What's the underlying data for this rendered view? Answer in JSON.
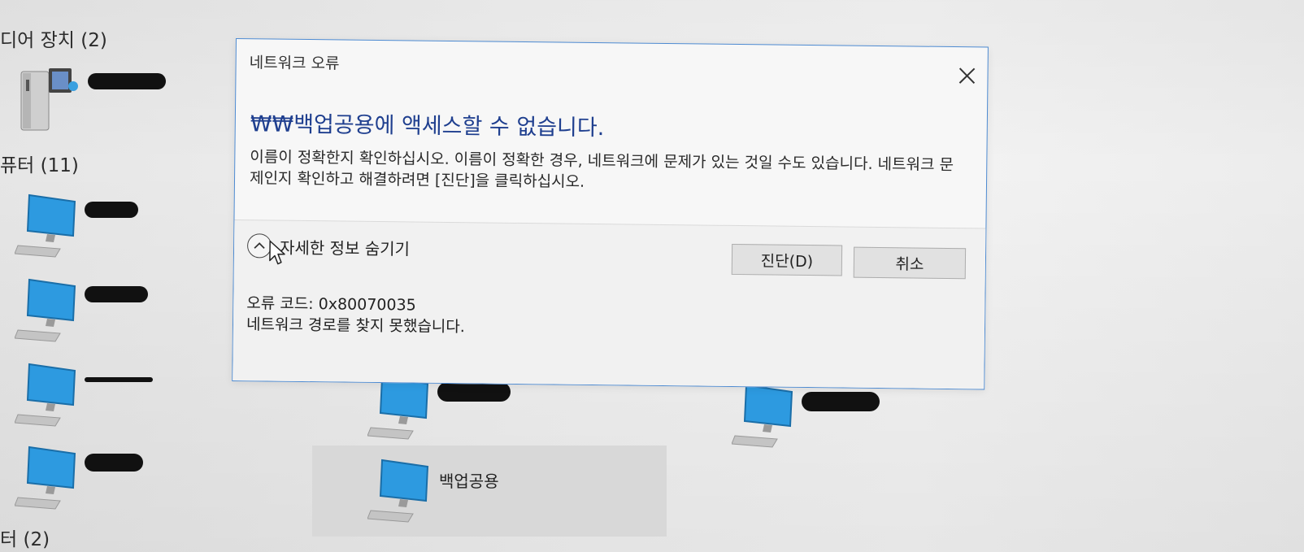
{
  "explorer": {
    "sections": [
      {
        "id": "media",
        "label": "디어 장치 (2)"
      },
      {
        "id": "computers",
        "label": "퓨터 (11)"
      },
      {
        "id": "printers",
        "label": "터 (2)"
      }
    ],
    "items": [
      {
        "id": "media-device",
        "type": "media-server",
        "label": "",
        "redacted": true
      },
      {
        "id": "pc-1",
        "type": "computer",
        "label": "",
        "redacted": true
      },
      {
        "id": "pc-2",
        "type": "computer",
        "label": "",
        "redacted": true
      },
      {
        "id": "pc-3",
        "type": "computer",
        "label": "",
        "redacted": true
      },
      {
        "id": "pc-4",
        "type": "computer",
        "label": "",
        "redacted": true
      },
      {
        "id": "pc-5",
        "type": "computer",
        "label": "",
        "redacted": true
      },
      {
        "id": "pc-6",
        "type": "computer",
        "label": "",
        "redacted": true
      },
      {
        "id": "pc-backup",
        "type": "computer",
        "label": "백업공용",
        "selected": true
      }
    ]
  },
  "dialog": {
    "title": "네트워크 오류",
    "heading": "₩₩백업공용에 액세스할 수 없습니다.",
    "message": "이름이 정확한지 확인하십시오. 이름이 정확한 경우, 네트워크에 문제가 있는 것일 수도 있습니다. 네트워크 문제인지 확인하고 해결하려면 [진단]을 클릭하십시오.",
    "details_toggle": "자세한 정보 숨기기",
    "buttons": {
      "diagnose": "진단(D)",
      "cancel": "취소"
    },
    "error_code": "오류 코드: 0x80070035",
    "error_description": "네트워크 경로를 찾지 못했습니다.",
    "accent_color": "#1f3f8f",
    "border_color": "#4d8ad1"
  },
  "icons": {
    "close": "close-icon",
    "chevron_up": "chevron-up-icon",
    "computer": "computer-icon",
    "media_server": "media-server-icon",
    "cursor": "mouse-pointer-icon"
  }
}
